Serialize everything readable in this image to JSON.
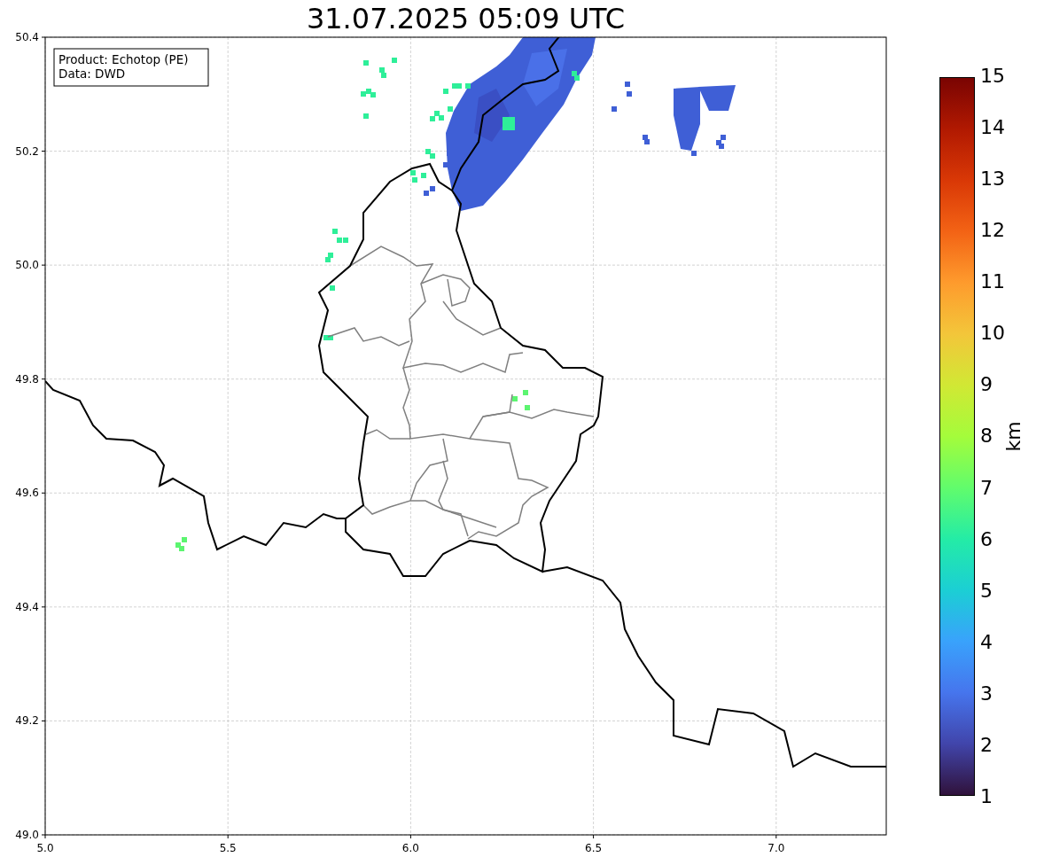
{
  "title": "31.07.2025 05:09 UTC",
  "legend": {
    "lines": [
      "Product: Echotop (PE)",
      "Data: DWD"
    ]
  },
  "x_ticks": [
    "5.0",
    "5.5",
    "6.0",
    "6.5",
    "7.0"
  ],
  "y_ticks": [
    "50.4",
    "50.2",
    "50.0",
    "49.8",
    "49.6",
    "49.4",
    "49.2",
    "49.0"
  ],
  "colorbar": {
    "label": "km",
    "ticks": [
      "15",
      "14",
      "13",
      "12",
      "11",
      "10",
      "9",
      "8",
      "7",
      "6",
      "5",
      "4",
      "3",
      "2",
      "1"
    ]
  }
}
